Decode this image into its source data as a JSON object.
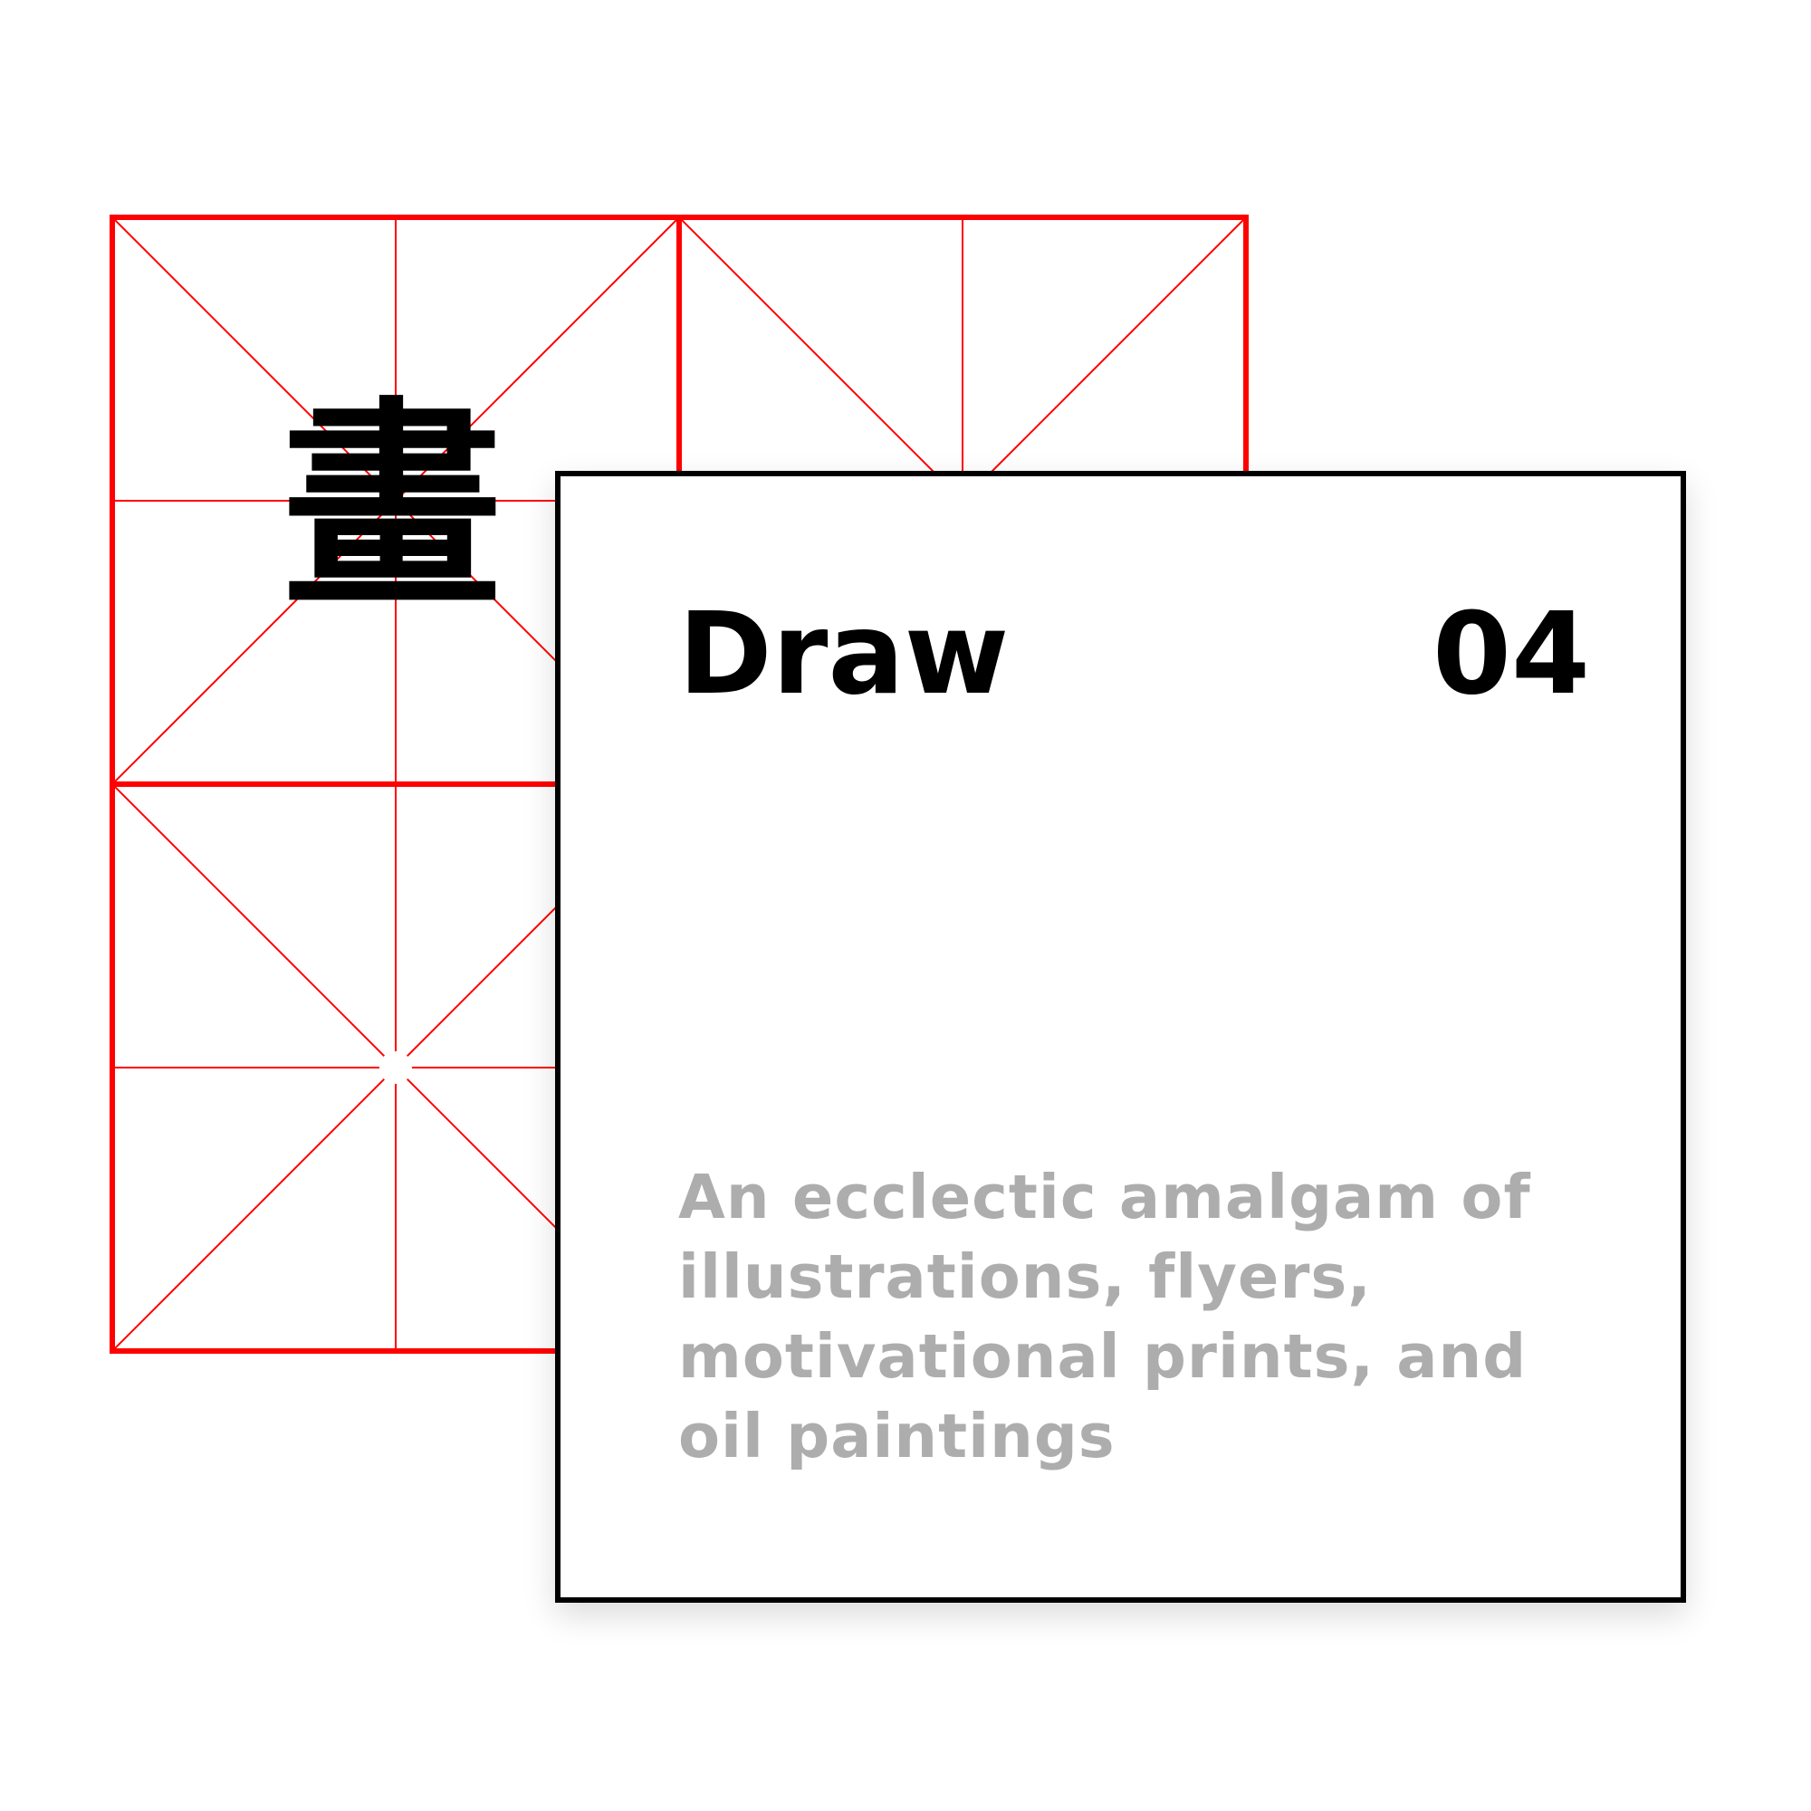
{
  "glyph": "畫",
  "card": {
    "title": "Draw",
    "number": "04",
    "description": "An ecclectic amalgam of illustrations, flyers, motivational prints, and oil paintings"
  },
  "colors": {
    "grid": "#ff0000",
    "text": "#000000",
    "description": "#adadad",
    "card_border": "#000000",
    "background": "#ffffff"
  },
  "icons": {
    "grid": "mi-zi-grid-icon"
  }
}
